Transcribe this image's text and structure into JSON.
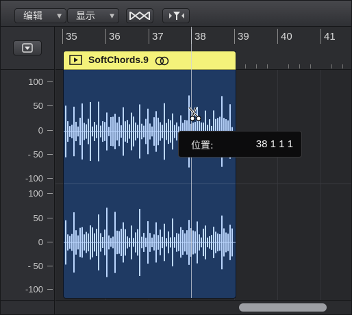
{
  "toolbar": {
    "edit_label": "编辑",
    "view_label": "显示",
    "menu_arrow": "▼"
  },
  "ruler": {
    "bars": [
      "35",
      "36",
      "37",
      "38",
      "39",
      "40",
      "41"
    ]
  },
  "region": {
    "name": "SoftChords.9",
    "color": "#f4f27a",
    "waveform_color": "#bcd7ff",
    "background": "#1f3a63"
  },
  "amplitude_axis": {
    "upper": [
      "100",
      "50",
      "0",
      "- 50",
      "-100"
    ],
    "lower": [
      "100",
      "50",
      "0",
      "- 50",
      "-100"
    ]
  },
  "tooltip": {
    "label": "位置:",
    "value": "38 1 1 1"
  },
  "playhead_bar": "38",
  "tool": "scissors-icon"
}
